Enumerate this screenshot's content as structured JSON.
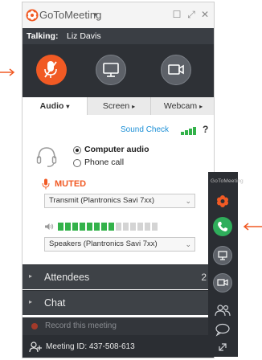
{
  "colors": {
    "accent_orange": "#f15a24",
    "green": "#33b24a",
    "dark_panel": "#2e3136",
    "link_blue": "#1b8fd6"
  },
  "app": {
    "name": "GoToMeeting",
    "caret": "▾"
  },
  "window_controls": {
    "restore": "☐",
    "minimize": "⤢",
    "close": "✕"
  },
  "talking": {
    "label": "Talking:",
    "name": "Liz Davis"
  },
  "controls": {
    "icons": [
      "microphone-icon",
      "screen-icon",
      "webcam-icon"
    ]
  },
  "tabs": [
    {
      "label": "Audio",
      "caret": "▾",
      "active": true
    },
    {
      "label": "Screen",
      "caret": "▸",
      "active": false
    },
    {
      "label": "Webcam",
      "caret": "▸",
      "active": false
    }
  ],
  "audio": {
    "sound_check_label": "Sound Check",
    "help_label": "?",
    "options": [
      {
        "label": "Computer audio",
        "selected": true
      },
      {
        "label": "Phone call",
        "selected": false
      }
    ],
    "muted_label": "MUTED",
    "transmit_value": "Transmit (Plantronics Savi 7xx)",
    "speaker_level": 0.6,
    "speakers_value": "Speakers (Plantronics Savi 7xx)"
  },
  "sections": [
    {
      "label": "Attendees",
      "count": "2"
    },
    {
      "label": "Chat",
      "count": ""
    }
  ],
  "record_label": "Record this meeting",
  "meeting_id": "Meeting ID: 437-508-613",
  "sidebar": {
    "brand": "GoToMeeting"
  }
}
